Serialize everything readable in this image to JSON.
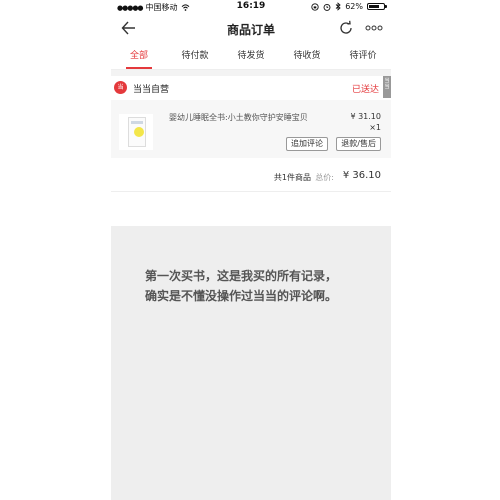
{
  "status_bar": {
    "carrier": "中国移动",
    "time": "16:19",
    "battery": "62%"
  },
  "header": {
    "title": "商品订单"
  },
  "tabs": [
    {
      "label": "全部",
      "active": true
    },
    {
      "label": "待付款",
      "active": false
    },
    {
      "label": "待发货",
      "active": false
    },
    {
      "label": "待收货",
      "active": false
    },
    {
      "label": "待评价",
      "active": false
    }
  ],
  "order": {
    "store_name": "当当自营",
    "status": "已送达",
    "side_tag": "当当",
    "product": {
      "name": "婴幼儿睡眠全书:小土教你守护安睡宝贝",
      "price": "¥ 31.10",
      "quantity": "×1"
    },
    "buttons": {
      "review": "追加评论",
      "refund": "退款/售后"
    },
    "summary": {
      "count": "共1件商品",
      "total_label": "总价:",
      "total_amount": "¥ 36.10"
    }
  },
  "note": {
    "line1": "第一次买书，这是我买的所有记录，",
    "line2": "确实是不懂没操作过当当的评论啊。"
  },
  "colors": {
    "accent": "#e4393c",
    "note_bg": "#eeeeee"
  }
}
